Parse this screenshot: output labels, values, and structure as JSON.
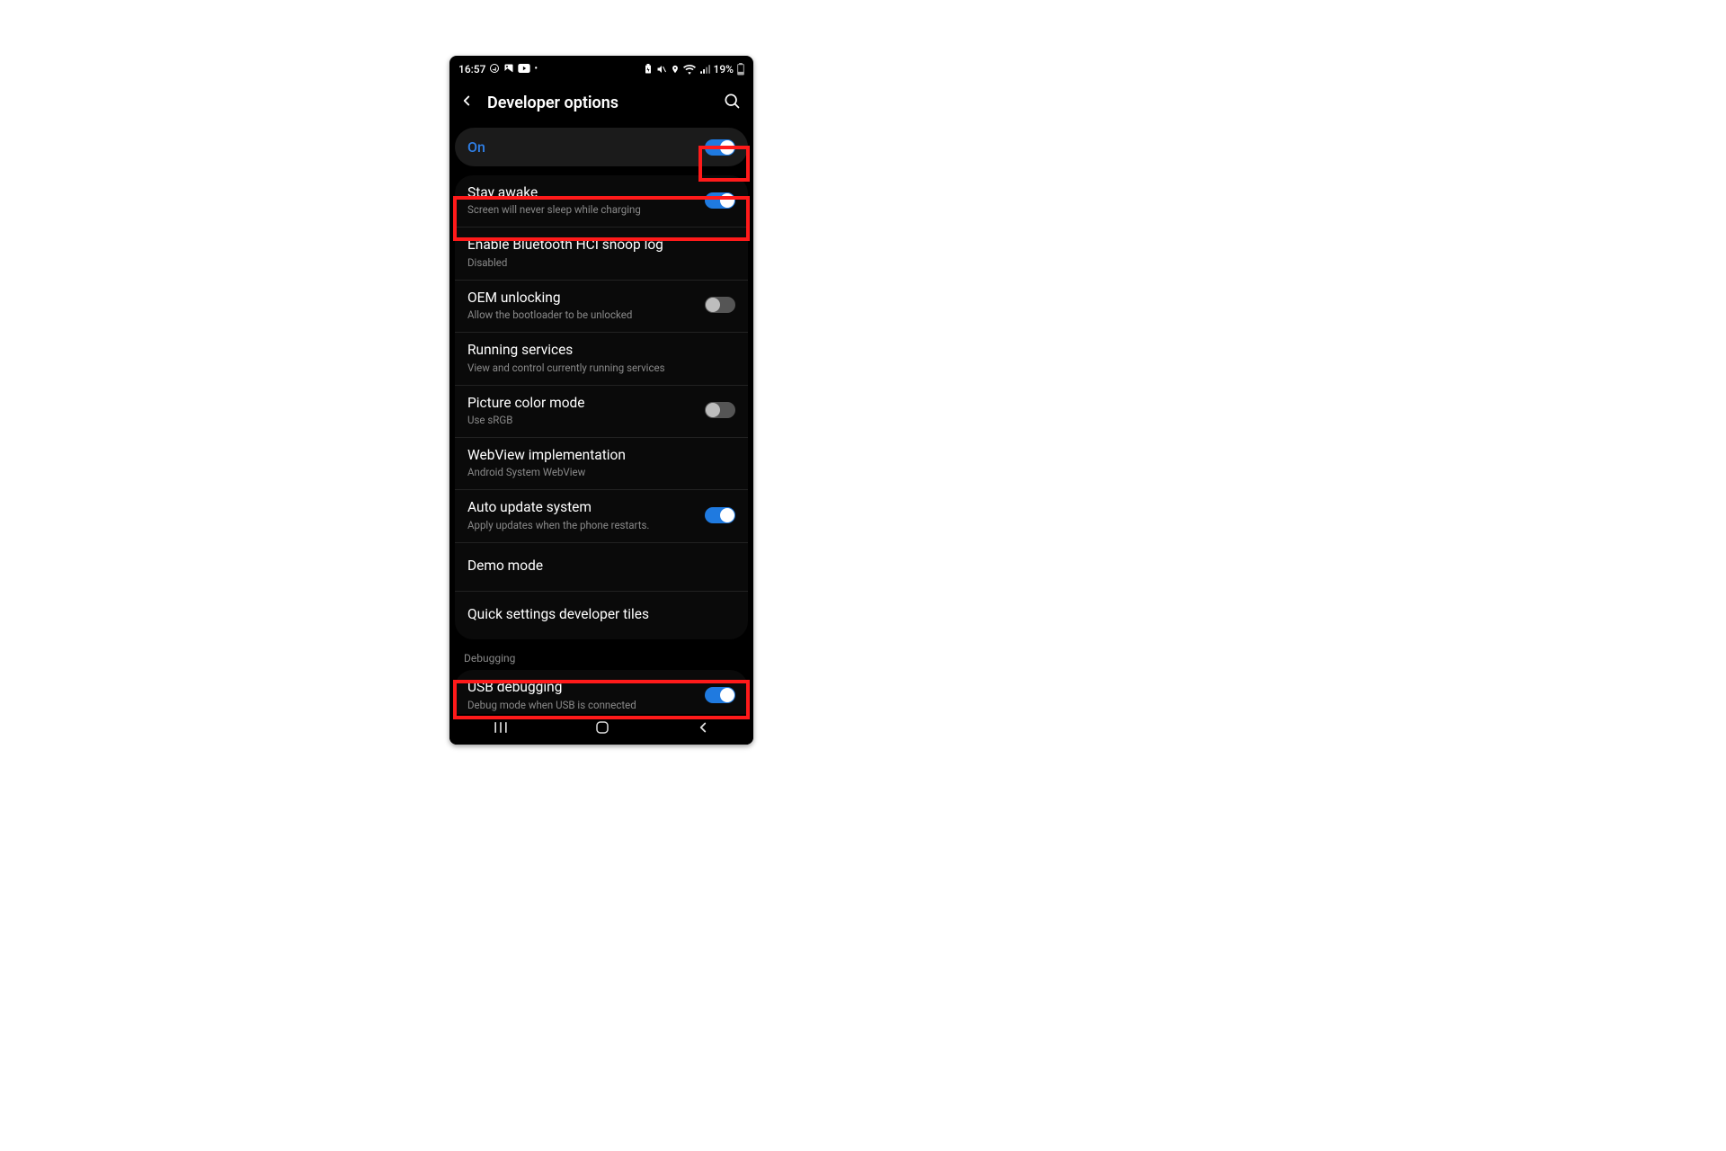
{
  "status": {
    "time": "16:57",
    "battery_text": "19%"
  },
  "header": {
    "title": "Developer options"
  },
  "master": {
    "label": "On",
    "enabled": true
  },
  "settings": [
    {
      "id": "stay-awake",
      "title": "Stay awake",
      "subtitle": "Screen will never sleep while charging",
      "toggle": true,
      "toggle_on": true,
      "highlighted": true
    },
    {
      "id": "bt-hci",
      "title": "Enable Bluetooth HCI snoop log",
      "subtitle": "Disabled",
      "toggle": false
    },
    {
      "id": "oem-unlock",
      "title": "OEM unlocking",
      "subtitle": "Allow the bootloader to be unlocked",
      "toggle": true,
      "toggle_on": false
    },
    {
      "id": "running-svc",
      "title": "Running services",
      "subtitle": "View and control currently running services",
      "toggle": false
    },
    {
      "id": "pic-color",
      "title": "Picture color mode",
      "subtitle": "Use sRGB",
      "toggle": true,
      "toggle_on": false
    },
    {
      "id": "webview",
      "title": "WebView implementation",
      "subtitle": "Android System WebView",
      "toggle": false
    },
    {
      "id": "auto-update",
      "title": "Auto update system",
      "subtitle": "Apply updates when the phone restarts.",
      "toggle": true,
      "toggle_on": true
    },
    {
      "id": "demo-mode",
      "title": "Demo mode",
      "subtitle": "",
      "toggle": false
    },
    {
      "id": "qs-tiles",
      "title": "Quick settings developer tiles",
      "subtitle": "",
      "toggle": false
    }
  ],
  "section_debugging": "Debugging",
  "debugging": [
    {
      "id": "usb-debug",
      "title": "USB debugging",
      "subtitle": "Debug mode when USB is connected",
      "toggle": true,
      "toggle_on": true,
      "highlighted": true
    }
  ],
  "highlight_master_toggle": true
}
